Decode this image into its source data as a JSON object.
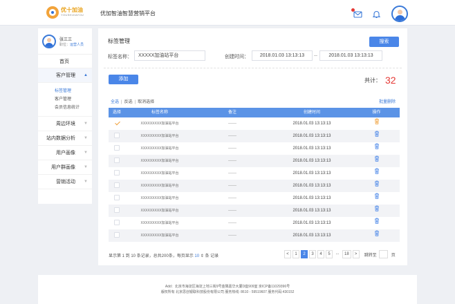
{
  "header": {
    "logo_main": "优十加油",
    "logo_sub": "YOUSHIJIAYOU",
    "platform_title": "优加智油智慧营销平台",
    "colors": {
      "primary": "#4a86e8",
      "accent": "#e9a21b",
      "danger": "#e53935"
    }
  },
  "user": {
    "name": "张三三",
    "role_label": "职位：",
    "role": "运营人员"
  },
  "sidebar": {
    "home": "首页",
    "customer": "客户管理",
    "sub": [
      "标签管理",
      "客户管理",
      "会员信息统计"
    ],
    "items": [
      "周边环境",
      "站内数据分析",
      "用户画像",
      "用户群画像",
      "营销活动"
    ]
  },
  "panel": {
    "title": "标签管理",
    "search_label": "搜索",
    "name_label": "标签名称：",
    "name_value": "XXXXX加油站平台",
    "time_label": "创建时间：",
    "start": "2018.01.03 13:13:13",
    "end": "2018.01.03 13:13:13",
    "add_label": "添加",
    "total_label": "共计：",
    "total": "32",
    "select_all": "全选",
    "invert": "反选",
    "cancel": "取消选择",
    "batch_delete": "批量删除"
  },
  "table": {
    "headers": [
      "选择",
      "标签名称",
      "备注",
      "创建时间",
      "操作"
    ],
    "rows": [
      {
        "name": "XXXXXXXXX加油站平台",
        "note": "——",
        "time": "2018.01.03 13:13:13",
        "checked": true
      },
      {
        "name": "XXXXXXXXX加油站平台",
        "note": "——",
        "time": "2018.01.03 13:13:13",
        "checked": false
      },
      {
        "name": "XXXXXXXXX加油站平台",
        "note": "——",
        "time": "2018.01.03 13:13:13",
        "checked": false
      },
      {
        "name": "XXXXXXXXX加油站平台",
        "note": "——",
        "time": "2018.01.03 13:13:13",
        "checked": false
      },
      {
        "name": "XXXXXXXXX加油站平台",
        "note": "——",
        "time": "2018.01.03 13:13:13",
        "checked": false
      },
      {
        "name": "XXXXXXXXX加油站平台",
        "note": "——",
        "time": "2018.01.03 13:13:13",
        "checked": false
      },
      {
        "name": "XXXXXXXXX加油站平台",
        "note": "——",
        "time": "2018.01.03 13:13:13",
        "checked": false
      },
      {
        "name": "XXXXXXXXX加油站平台",
        "note": "——",
        "time": "2018.01.03 13:13:13",
        "checked": false
      },
      {
        "name": "XXXXXXXXX加油站平台",
        "note": "——",
        "time": "2018.01.03 13:13:13",
        "checked": false
      },
      {
        "name": "XXXXXXXXX加油站平台",
        "note": "——",
        "time": "2018.01.03 13:13:13",
        "checked": false
      }
    ]
  },
  "pagination": {
    "info_a": "显示第 1 到 10 条记录，总共200条，每页显示",
    "per_page": "10",
    "info_b": "条 记录",
    "pages": [
      "<",
      "1",
      "2",
      "3",
      "4",
      "5",
      "...",
      "18",
      ">"
    ],
    "active_page": "2",
    "goto_label": "跳转至",
    "page_unit": "页"
  },
  "footer": {
    "line1": "Add：北京市海淀区海淀上地三街9号金隅嘉华大厦D座909室   京ICP备11029396号",
    "line2": "版权所有 北京思创银联科技股份有限公司 服务热线: 8610 - 59519607 服务代码:430152"
  }
}
